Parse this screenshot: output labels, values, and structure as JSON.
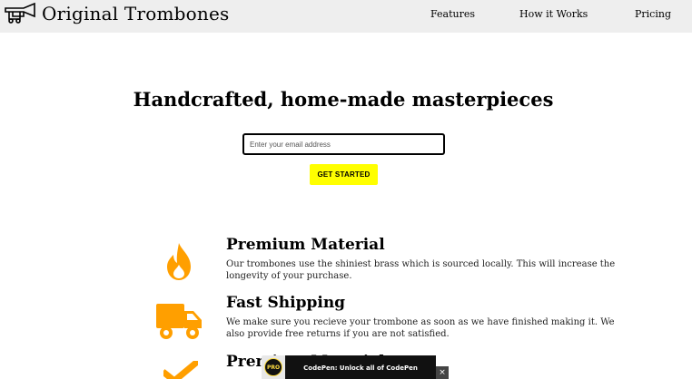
{
  "header": {
    "brand": "Original Trombones",
    "nav": {
      "features": "Features",
      "how_it_works": "How it Works",
      "pricing": "Pricing"
    }
  },
  "hero": {
    "title": "Handcrafted, home-made masterpieces",
    "email_placeholder": "Enter your email address",
    "cta_label": "GET STARTED"
  },
  "features": [
    {
      "icon": "fire-icon",
      "title": "Premium Material",
      "text": "Our trombones use the shiniest brass which is sourced locally. This will increase the longevity of your purchase."
    },
    {
      "icon": "truck-icon",
      "title": "Fast Shipping",
      "text": "We make sure you recieve your trombone as soon as we have finished making it. We also provide free returns if you are not satisfied."
    },
    {
      "icon": "check-icon",
      "title": "Premium Material"
    }
  ],
  "codepen_banner": {
    "badge": "PRO",
    "text": "CodePen: Unlock all of CodePen",
    "close": "×"
  },
  "colors": {
    "header_bg": "#eeeeee",
    "accent_orange": "#ff9f00",
    "cta_yellow": "#ffff00"
  }
}
